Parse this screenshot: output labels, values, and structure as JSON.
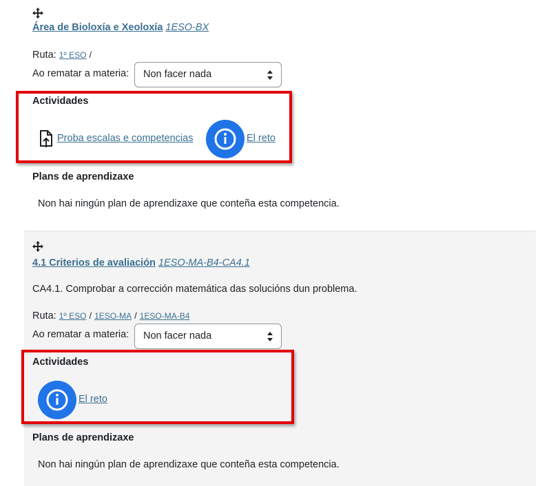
{
  "competency1": {
    "title": "Área de Bioloxía e Xeoloxía",
    "idnumber": "1ESO-BX",
    "path_label": "Ruta:",
    "path": [
      "1º ESO"
    ],
    "path_separator": "/",
    "completion_label": "Ao rematar a materia:",
    "completion_value": "Non facer nada",
    "activities_heading": "Actividades",
    "activities": [
      {
        "label": "Proba escalas e competencias",
        "icon": "file-upload-icon"
      },
      {
        "label": "El reto",
        "icon": "info-icon"
      }
    ],
    "plans_heading": "Plans de aprendizaxe",
    "plans_empty": "Non hai ningún plan de aprendizaxe que conteña esta competencia."
  },
  "competency2": {
    "title": "4.1 Criterios de avaliación",
    "idnumber": "1ESO-MA-B4-CA4.1",
    "description": "CA4.1. Comprobar a corrección matemática das solucións dun problema.",
    "path_label": "Ruta:",
    "path": [
      "1º ESO",
      "1ESO-MA",
      "1ESO-MA-B4"
    ],
    "path_separator": "/",
    "completion_label": "Ao rematar a materia:",
    "completion_value": "Non facer nada",
    "activities_heading": "Actividades",
    "activities": [
      {
        "label": "El reto",
        "icon": "info-icon"
      }
    ],
    "plans_heading": "Plans de aprendizaxe",
    "plans_empty": "Non hai ningún plan de aprendizaxe que conteña esta competencia."
  },
  "colors": {
    "link": "#3a6f92",
    "highlight": "#e30000",
    "info_icon": "#1f74e8",
    "section_bg": "#f4f4f4"
  }
}
